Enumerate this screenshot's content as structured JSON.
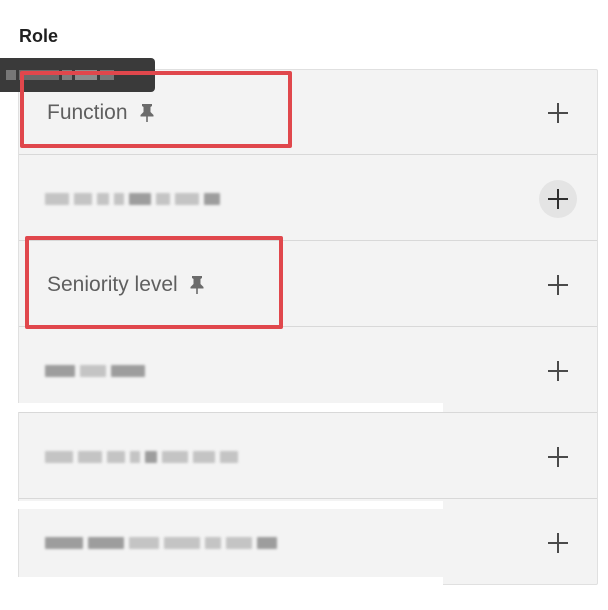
{
  "section": {
    "title": "Role"
  },
  "filters": [
    {
      "label": "Function",
      "pinned": true,
      "obscured": false
    },
    {
      "label": "",
      "pinned": false,
      "obscured": true
    },
    {
      "label": "Seniority level",
      "pinned": true,
      "obscured": false
    },
    {
      "label": "",
      "pinned": false,
      "obscured": true
    },
    {
      "label": "",
      "pinned": false,
      "obscured": true
    },
    {
      "label": "",
      "pinned": false,
      "obscured": true
    }
  ],
  "icons": {
    "pin": "pin-icon",
    "add": "plus-icon"
  },
  "colors": {
    "highlight": "#e0474c",
    "panel_bg": "#f3f3f3",
    "label_text": "#5f5f5f",
    "tooltip_bg": "#3a3a3a"
  }
}
